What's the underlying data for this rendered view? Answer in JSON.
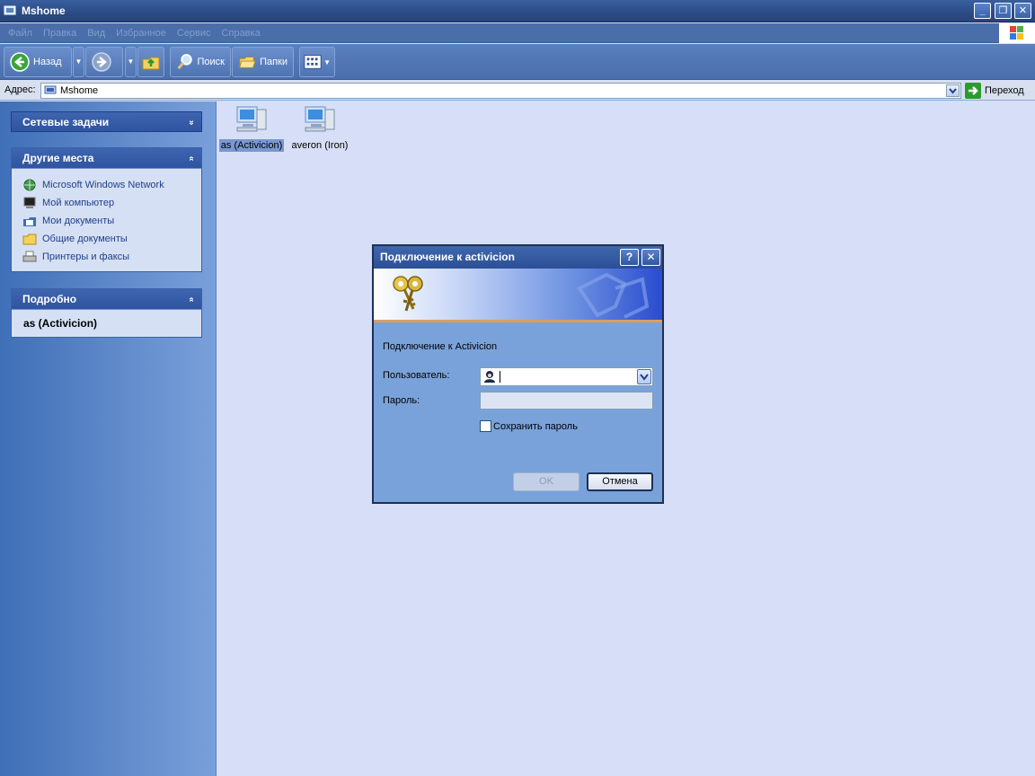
{
  "window": {
    "title": "Mshome",
    "buttons": {
      "minimize": "_",
      "maximize": "❐",
      "close": "✕"
    }
  },
  "menu": [
    "Файл",
    "Правка",
    "Вид",
    "Избранное",
    "Сервис",
    "Справка"
  ],
  "toolbar": {
    "back_label": "Назад",
    "search_label": "Поиск",
    "folders_label": "Папки"
  },
  "address": {
    "label": "Адрес:",
    "value": "Mshome",
    "go_label": "Переход"
  },
  "sidebar": {
    "network_tasks": {
      "title": "Сетевые задачи",
      "chevron": "»"
    },
    "other_places": {
      "title": "Другие места",
      "chevron": "«",
      "items": [
        {
          "label": "Microsoft Windows Network",
          "icon": "network-globe-icon"
        },
        {
          "label": "Мой компьютер",
          "icon": "my-computer-icon"
        },
        {
          "label": "Мои документы",
          "icon": "my-documents-icon"
        },
        {
          "label": "Общие документы",
          "icon": "shared-folder-icon"
        },
        {
          "label": "Принтеры и факсы",
          "icon": "printer-icon"
        }
      ]
    },
    "details": {
      "title": "Подробно",
      "chevron": "«",
      "value": "as (Activicion)"
    }
  },
  "computers": [
    {
      "label": "as (Activicion)",
      "selected": true
    },
    {
      "label": "averon (Iron)",
      "selected": false
    }
  ],
  "dialog": {
    "title": "Подключение к activicion",
    "help": "?",
    "close": "✕",
    "connect_text": "Подключение к Activicion",
    "user_label": "Пользователь:",
    "user_value": "",
    "password_label": "Пароль:",
    "save_password_label": "Сохранить пароль",
    "save_password_checked": false,
    "ok_label": "OK",
    "cancel_label": "Отмена"
  },
  "colors": {
    "titlebar": "#2a4b86",
    "sidebar_link": "#1f3f8a",
    "selection": "#7997d1",
    "content_bg": "#d6dff7"
  }
}
